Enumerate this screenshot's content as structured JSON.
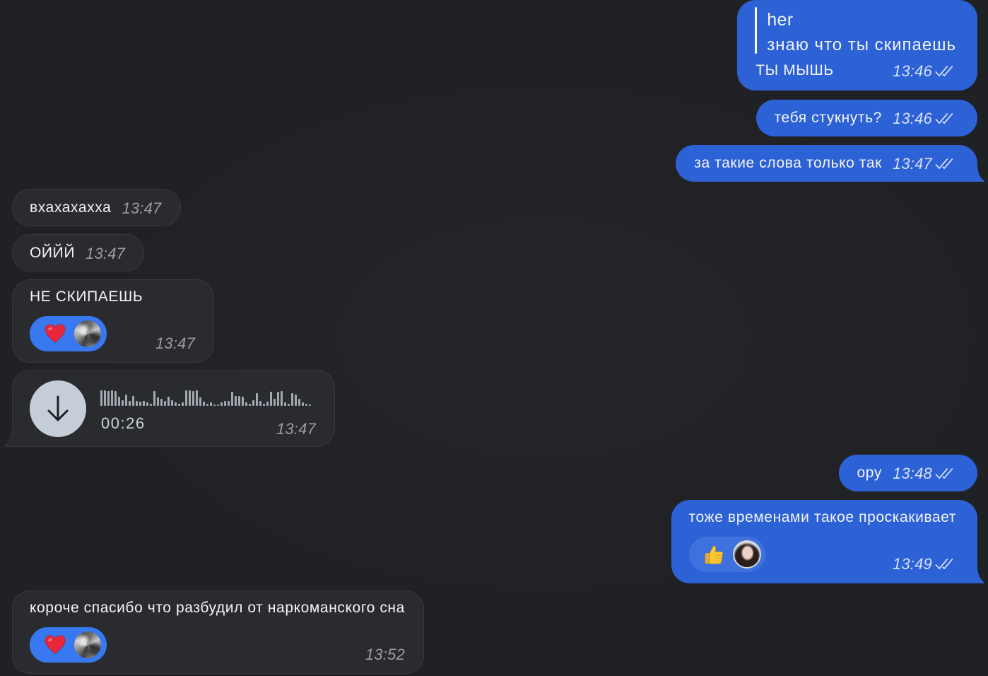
{
  "colors": {
    "background": "#202124",
    "outgoing_bubble": "#2d61d6",
    "incoming_bubble": "#2a2b2e",
    "incoming_bubble_border": "#38393d",
    "reaction_pill_incoming": "#3878f0",
    "reaction_pill_outgoing": "#3e71de",
    "incoming_time": "#9a9ca2",
    "outgoing_time": "#d6e0fa",
    "read_checks": "#dbe4fa",
    "voice_button": "#c5cdd9",
    "waveform": "#a3a9b2"
  },
  "messages": [
    {
      "reply": {
        "author": "her",
        "text": "знаю что ты скипаешь"
      },
      "text": "ТЫ МЫШЬ",
      "time": "13:46",
      "status_icon": "double-check-icon"
    },
    {
      "text": "тебя стукнуть?",
      "time": "13:46",
      "status_icon": "double-check-icon"
    },
    {
      "text": "за такие слова только так",
      "time": "13:47",
      "status_icon": "double-check-icon"
    },
    {
      "text": "вхахахахха",
      "time": "13:47"
    },
    {
      "text": "ОЙЙЙ",
      "time": "13:47"
    },
    {
      "text": "НЕ СКИПАЕШЬ",
      "time": "13:47",
      "reaction": {
        "emoji_icon": "red-heart-icon",
        "reactor_avatar_icon": "cat-avatar"
      }
    },
    {
      "voice": {
        "action_icon": "download-arrow-icon",
        "duration": "00:26",
        "waveform": [
          0.95,
          0.95,
          0.9,
          0.95,
          0.9,
          0.55,
          0.35,
          0.7,
          0.3,
          0.6,
          0.3,
          0.25,
          0.3,
          0.2,
          0.15,
          0.9,
          0.5,
          0.45,
          0.3,
          0.55,
          0.35,
          0.2,
          0.15,
          0.2,
          0.95,
          0.95,
          0.9,
          0.95,
          0.5,
          0.25,
          0.15,
          0.2,
          0.1,
          0.1,
          0.2,
          0.3,
          0.3,
          0.85,
          0.6,
          0.6,
          0.55,
          0.2,
          0.15,
          0.35,
          0.8,
          0.3,
          0.15,
          0.25,
          0.85,
          0.45,
          0.85,
          0.9,
          0.2,
          0.15,
          0.8,
          0.7,
          0.45,
          0.2,
          0.15,
          0.1
        ]
      },
      "time": "13:47"
    },
    {
      "text": "ору",
      "time": "13:48",
      "status_icon": "double-check-icon"
    },
    {
      "text": "тоже временами такое проскакивает",
      "time": "13:49",
      "status_icon": "double-check-icon",
      "reaction": {
        "emoji_icon": "thumbs-up-icon",
        "reactor_avatar_icon": "girl-avatar"
      }
    },
    {
      "text": "короче спасибо что разбудил от наркоманского сна",
      "time": "13:52",
      "reaction": {
        "emoji_icon": "red-heart-icon",
        "reactor_avatar_icon": "cat-avatar"
      }
    }
  ]
}
